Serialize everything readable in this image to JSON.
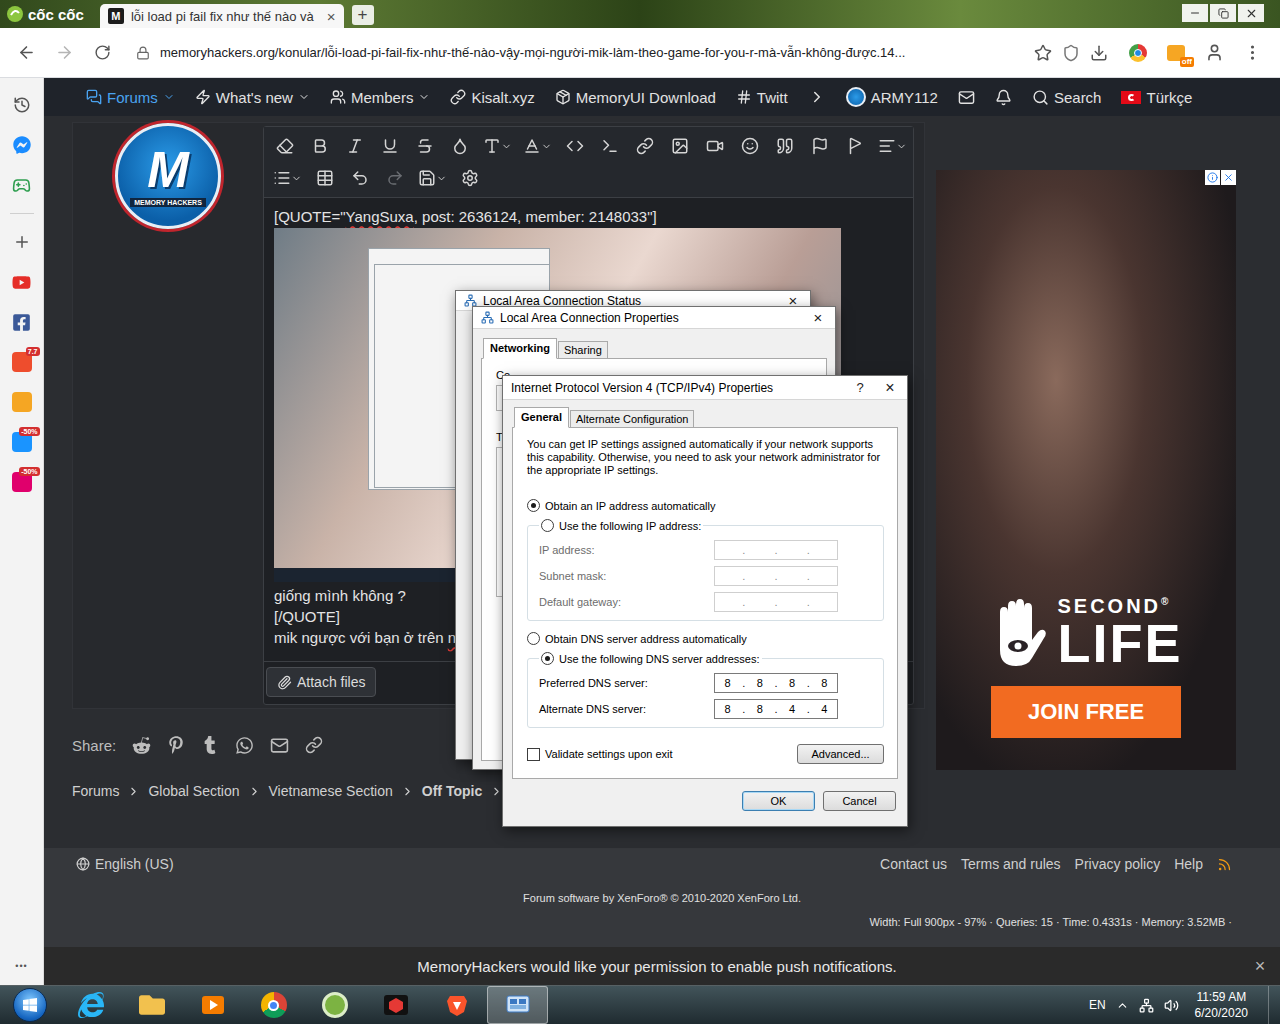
{
  "browser": {
    "brand": "cốc cốc",
    "tabs": [
      {
        "title": "lỗi load pi fail fix như thế nào và",
        "favicon": "M",
        "close": "×",
        "selected": true
      }
    ],
    "new_tab": "+",
    "url": "memoryhackers.org/konular/lỗi-load-pi-fail-fix-như-thế-nào-vậy-mọi-người-mik-làm-theo-game-for-you-r-mà-vẫn-không-được.14...",
    "extension_badge": "off"
  },
  "sidebar": {
    "items": [
      {
        "kind": "history"
      },
      {
        "kind": "messenger"
      },
      {
        "kind": "game"
      },
      {
        "kind": "add"
      },
      {
        "kind": "youtube"
      },
      {
        "kind": "facebook"
      },
      {
        "kind": "shop",
        "color": "#ee4d2d",
        "badge": "7.7"
      },
      {
        "kind": "shop",
        "color": "#f5a623"
      },
      {
        "kind": "shop",
        "color": "#1a94ff",
        "badge": "-50%"
      },
      {
        "kind": "shop",
        "color": "#e0006c",
        "badge": "-50%"
      }
    ],
    "more": "•••"
  },
  "forum": {
    "nav": [
      {
        "label": "Forums",
        "selected": true,
        "dropdown": true
      },
      {
        "label": "What's new",
        "selected": false,
        "dropdown": true
      },
      {
        "label": "Members",
        "selected": false,
        "dropdown": true
      },
      {
        "label": "Kisalt.xyz",
        "selected": false,
        "dropdown": false
      },
      {
        "label": "MemoryUI Download",
        "selected": false,
        "dropdown": false
      },
      {
        "label": "Twitt",
        "selected": false,
        "dropdown": false
      }
    ],
    "user": "ARMY112",
    "search": "Search",
    "language": "Türkçe",
    "avatar": {
      "mark": "M",
      "caption": "MEMORY HACKERS"
    },
    "editor": {
      "quote_open": "[QUOTE=\"",
      "quote_author": "YangSuxa",
      "quote_meta": ", post: 2636124, member: 2148033\"]",
      "quote_body": "giống mình không ?",
      "quote_close": "[/QUOTE]",
      "reply": "mik ngược với bạn ở trên ",
      "reply_flagged": "n",
      "attach": "Attach files"
    },
    "ad": {
      "brand_top": "SECOND",
      "brand": "LIFE",
      "registered": "®",
      "cta": "JOIN FREE"
    },
    "share": {
      "label": "Share:"
    },
    "breadcrumb": [
      {
        "label": "Forums",
        "current": false
      },
      {
        "label": "Global Section",
        "current": false
      },
      {
        "label": "Vietnamese Section",
        "current": false
      },
      {
        "label": "Off Topic",
        "current": true
      }
    ],
    "footer": {
      "language": "English (US)",
      "links": [
        "Contact us",
        "Terms and rules",
        "Privacy policy",
        "Help"
      ],
      "credit": "Forum software by XenForo® © 2010-2020 XenForo Ltd.",
      "stats": "Width: Full 900px - 97% · Queries: 15 · Time: 0.4331s · Memory: 3.52MB ·"
    },
    "push": {
      "text": "MemoryHackers would like your permission to enable push notifications.",
      "close": "×"
    }
  },
  "windows": {
    "status": {
      "title": "Local Area Connection Status",
      "close": "×"
    },
    "properties": {
      "title": "Local Area Connection Properties",
      "close": "×",
      "tabs": [
        {
          "label": "Networking",
          "selected": true
        },
        {
          "label": "Sharing",
          "selected": false
        }
      ],
      "cut_labels": [
        "Co",
        "T"
      ]
    },
    "ipv4": {
      "title": "Internet Protocol Version 4 (TCP/IPv4) Properties",
      "help": "?",
      "close": "×",
      "tabs": [
        {
          "label": "General",
          "selected": true
        },
        {
          "label": "Alternate Configuration",
          "selected": false
        }
      ],
      "intro": "You can get IP settings assigned automatically if your network supports this capability. Otherwise, you need to ask your network administrator for the appropriate IP settings.",
      "ip_auto": {
        "label": "Obtain an IP address automatically",
        "selected": true
      },
      "ip_manual": {
        "label": "Use the following IP address:",
        "selected": false
      },
      "ip_fields": [
        {
          "label": "IP address:",
          "octets": [
            "",
            "",
            "",
            ""
          ],
          "disabled": true
        },
        {
          "label": "Subnet mask:",
          "octets": [
            "",
            "",
            "",
            ""
          ],
          "disabled": true
        },
        {
          "label": "Default gateway:",
          "octets": [
            "",
            "",
            "",
            ""
          ],
          "disabled": true
        }
      ],
      "dns_auto": {
        "label": "Obtain DNS server address automatically",
        "selected": false
      },
      "dns_manual": {
        "label": "Use the following DNS server addresses:",
        "selected": true
      },
      "dns_fields": [
        {
          "label": "Preferred DNS server:",
          "octets": [
            "8",
            "8",
            "8",
            "8"
          ],
          "disabled": false
        },
        {
          "label": "Alternate DNS server:",
          "octets": [
            "8",
            "8",
            "4",
            "4"
          ],
          "disabled": false
        }
      ],
      "separator": ".",
      "validate": {
        "label": "Validate settings upon exit",
        "checked": false
      },
      "advanced": "Advanced...",
      "ok": "OK",
      "cancel": "Cancel"
    }
  },
  "taskbar": {
    "apps": [
      {
        "kind": "ie",
        "active": false
      },
      {
        "kind": "explorer",
        "active": false
      },
      {
        "kind": "media",
        "active": false
      },
      {
        "kind": "chrome",
        "active": false
      },
      {
        "kind": "coccoc",
        "active": false
      },
      {
        "kind": "garena",
        "active": false
      },
      {
        "kind": "brave",
        "active": false
      },
      {
        "kind": "network",
        "active": true
      }
    ],
    "language": "EN",
    "time": "11:59 AM",
    "date": "6/20/2020"
  }
}
